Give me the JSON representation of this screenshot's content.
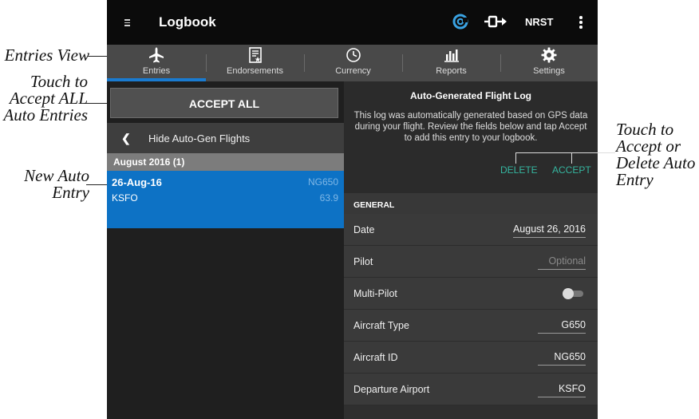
{
  "annotations": {
    "entries_view": "Entries View",
    "accept_all_lines": [
      "Touch to",
      "Accept ALL",
      "Auto Entries"
    ],
    "new_auto_entry_lines": [
      "New Auto",
      "Entry"
    ],
    "accept_delete_lines": [
      "Touch to",
      "Accept or",
      "Delete Auto",
      "Entry"
    ]
  },
  "topbar": {
    "title": "Logbook",
    "nrst": "NRST",
    "icons": [
      "menu-icon",
      "garmin-pilot-icon",
      "route-icon",
      "more-options-icon"
    ]
  },
  "tabs": [
    {
      "label": "Entries",
      "icon": "airplane-icon",
      "selected": true
    },
    {
      "label": "Endorsements",
      "icon": "endorsement-icon",
      "selected": false
    },
    {
      "label": "Currency",
      "icon": "clock-icon",
      "selected": false
    },
    {
      "label": "Reports",
      "icon": "bar-chart-icon",
      "selected": false
    },
    {
      "label": "Settings",
      "icon": "gear-icon",
      "selected": false
    }
  ],
  "left": {
    "accept_all": "ACCEPT ALL",
    "hide_label": "Hide Auto-Gen Flights",
    "month": "August 2016 (1)",
    "entry": {
      "date": "26-Aug-16",
      "aircraft": "NG650",
      "airport": "KSFO",
      "time": "63.9"
    }
  },
  "right": {
    "banner_title": "Auto-Generated Flight Log",
    "banner_message": "This log was automatically generated based on GPS data during your flight. Review the fields below and tap Accept to add this entry to your logbook.",
    "delete": "DELETE",
    "accept": "ACCEPT",
    "section": "GENERAL",
    "rows": [
      {
        "label": "Date",
        "value": "August 26, 2016"
      },
      {
        "label": "Pilot",
        "placeholder": "Optional"
      },
      {
        "label": "Multi-Pilot",
        "toggle": false
      },
      {
        "label": "Aircraft Type",
        "value": "G650"
      },
      {
        "label": "Aircraft ID",
        "value": "NG650"
      },
      {
        "label": "Departure Airport",
        "value": "KSFO"
      }
    ]
  },
  "colors": {
    "accent_blue": "#0d72c5",
    "teal_action": "#35b6a0",
    "tab_bar": "#494949"
  }
}
